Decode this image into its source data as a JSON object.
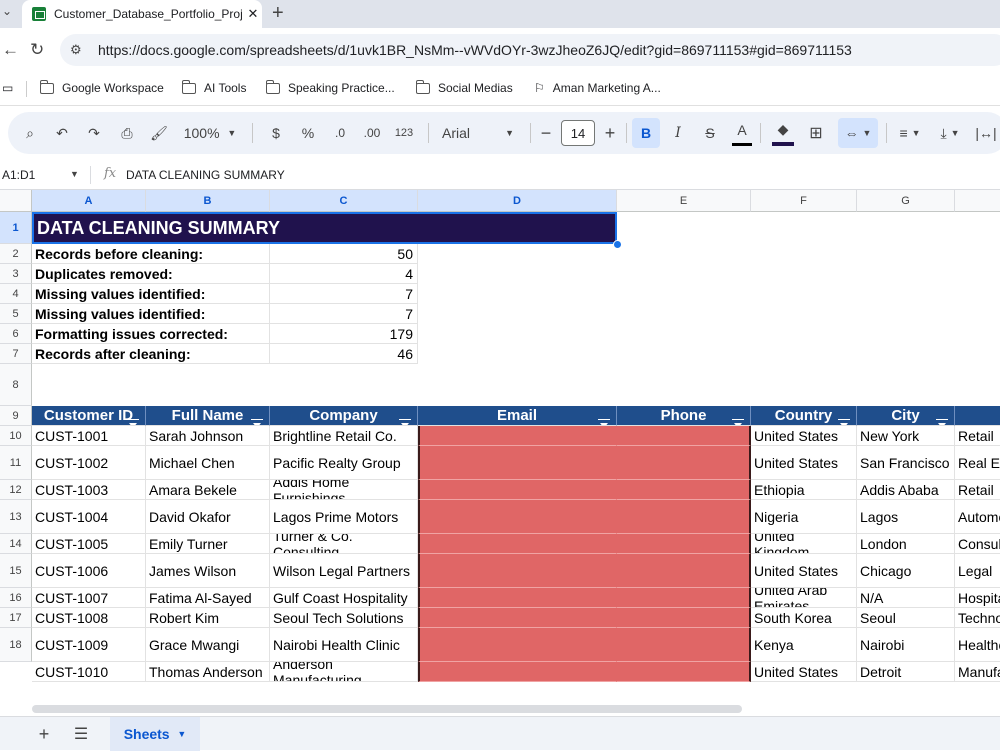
{
  "browser": {
    "tab_title": "Customer_Database_Portfolio_Proj",
    "tab_close": "✕",
    "new_tab": "+",
    "url": "https://docs.google.com/spreadsheets/d/1uvk1BR_NsMm--vWVdOYr-3wzJheoZ6JQ/edit?gid=869711153#gid=869711153",
    "bookmarks": [
      "Google Workspace",
      "AI Tools",
      "Speaking Practice...",
      "Social Medias",
      "Aman Marketing A..."
    ]
  },
  "toolbar": {
    "zoom": "100%",
    "currency": "$",
    "percent": "%",
    "dec_decrease": ".0",
    "dec_increase": ".00",
    "number_format": "123",
    "font": "Arial",
    "font_size": "14",
    "bold": "B",
    "italic": "I",
    "text_color": "A"
  },
  "formula_bar": {
    "name_box": "A1:D1",
    "fx": "fx",
    "content": "DATA CLEANING SUMMARY"
  },
  "columns": [
    "A",
    "B",
    "C",
    "D",
    "E",
    "F",
    "G",
    "H"
  ],
  "rows": [
    "1",
    "2",
    "3",
    "4",
    "5",
    "6",
    "7",
    "8",
    "9",
    "10",
    "11",
    "12",
    "13",
    "14",
    "15",
    "16",
    "17",
    "18"
  ],
  "summary": {
    "title": "DATA CLEANING SUMMARY",
    "items": [
      {
        "label": "Records before cleaning:",
        "value": "50"
      },
      {
        "label": "Duplicates removed:",
        "value": "4"
      },
      {
        "label": "Missing values identified:",
        "value": "7"
      },
      {
        "label": "Missing values identified:",
        "value": "7"
      },
      {
        "label": "Formatting issues corrected:",
        "value": "179"
      },
      {
        "label": "Records after cleaning:",
        "value": "46"
      }
    ]
  },
  "table": {
    "headers": [
      "Customer ID",
      "Full Name",
      "Company",
      "Email",
      "Phone",
      "Country",
      "City",
      "Indus"
    ],
    "rows": [
      [
        "CUST-1001",
        "Sarah Johnson",
        "Brightline Retail Co.",
        "",
        "",
        "United States",
        "New York",
        "Retail"
      ],
      [
        "CUST-1002",
        "Michael Chen",
        "Pacific Realty Group",
        "",
        "",
        "United States",
        "San Francisco",
        "Real Es"
      ],
      [
        "CUST-1003",
        "Amara Bekele",
        "Addis Home Furnishings",
        "",
        "",
        "Ethiopia",
        "Addis Ababa",
        "Retail"
      ],
      [
        "CUST-1004",
        "David Okafor",
        "Lagos Prime Motors",
        "",
        "",
        "Nigeria",
        "Lagos",
        "Automo"
      ],
      [
        "CUST-1005",
        "Emily Turner",
        "Turner & Co. Consulting",
        "",
        "",
        "United Kingdom",
        "London",
        "Consul"
      ],
      [
        "CUST-1006",
        "James Wilson",
        "Wilson Legal Partners",
        "",
        "",
        "United States",
        "Chicago",
        "Legal"
      ],
      [
        "CUST-1007",
        "Fatima Al-Sayed",
        "Gulf Coast Hospitality",
        "",
        "",
        "United Arab Emirates",
        "N/A",
        "Hospita"
      ],
      [
        "CUST-1008",
        "Robert Kim",
        "Seoul Tech Solutions",
        "",
        "",
        "South Korea",
        "Seoul",
        "Techno"
      ],
      [
        "CUST-1009",
        "Grace Mwangi",
        "Nairobi Health Clinic",
        "",
        "",
        "Kenya",
        "Nairobi",
        "Healthc"
      ],
      [
        "CUST-1010",
        "Thomas Anderson",
        "Anderson Manufacturing",
        "",
        "",
        "United States",
        "Detroit",
        "Manufa g"
      ]
    ]
  },
  "sheet_tab": "Sheets",
  "colors": {
    "title_bg": "#20124d",
    "header_bg": "#1f4e8c",
    "highlight_red": "#e06666"
  }
}
